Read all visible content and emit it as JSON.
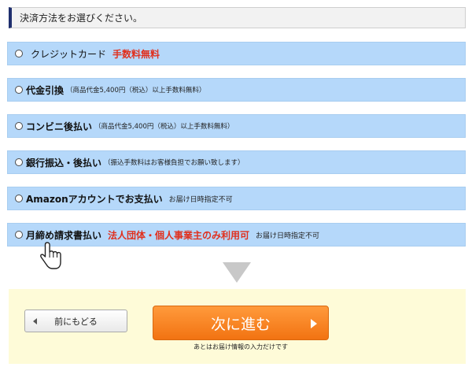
{
  "header": {
    "title": "決済方法をお選びください。"
  },
  "options": [
    {
      "label": "クレジットカード",
      "badge": "手数料無料"
    },
    {
      "label": "代金引換",
      "note": "（商品代金5,400円（税込）以上手数料無料）"
    },
    {
      "label": "コンビニ後払い",
      "note": "（商品代金5,400円（税込）以上手数料無料）"
    },
    {
      "label": "銀行振込・後払い",
      "note": "（振込手数料はお客様負担でお願い致します）"
    },
    {
      "label": "Amazonアカウントでお支払い",
      "note": "お届け日時指定不可"
    },
    {
      "label": "月締め請求書払い",
      "badge": "法人団体・個人事業主のみ利用可",
      "note": "お届け日時指定不可"
    }
  ],
  "nav": {
    "back_label": "前にもどる",
    "next_label": "次に進む",
    "next_caption": "あとはお届け情報の入力だけです"
  },
  "colors": {
    "accent": "#f27312",
    "option_bg": "#b5d8fa",
    "alert_red": "#e0301e",
    "footer_bg": "#fefbd8",
    "header_bar": "#1f2f6e"
  }
}
